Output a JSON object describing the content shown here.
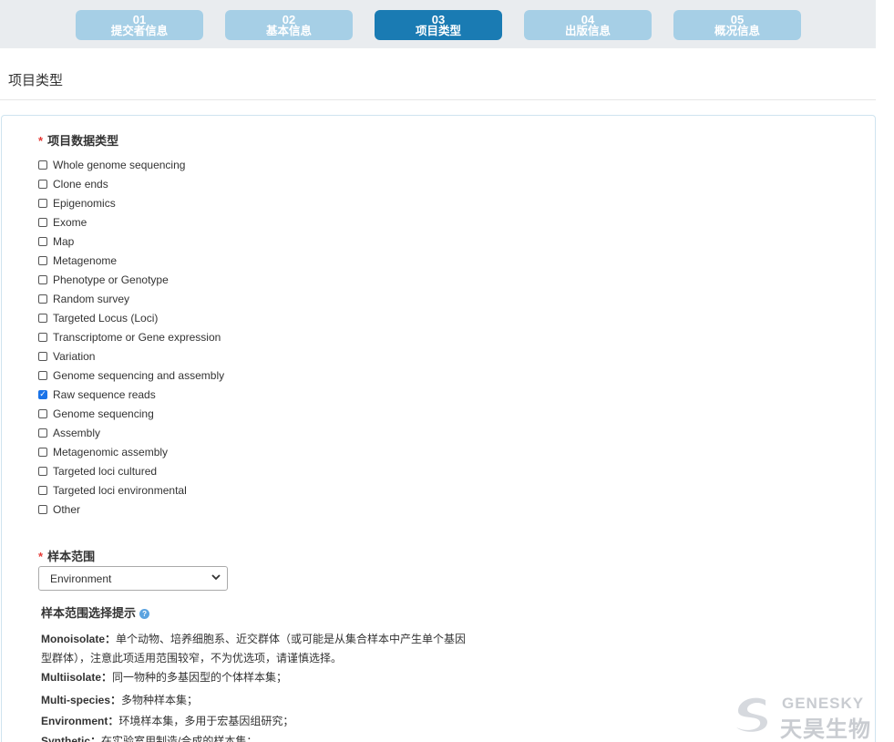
{
  "steps": [
    {
      "num": "01",
      "label": "提交者信息",
      "active": false
    },
    {
      "num": "02",
      "label": "基本信息",
      "active": false
    },
    {
      "num": "03",
      "label": "项目类型",
      "active": true
    },
    {
      "num": "04",
      "label": "出版信息",
      "active": false
    },
    {
      "num": "05",
      "label": "概况信息",
      "active": false
    }
  ],
  "section_title": "项目类型",
  "data_type": {
    "required_mark": "*",
    "label": "项目数据类型",
    "options": [
      {
        "label": "Whole genome sequencing",
        "checked": false
      },
      {
        "label": "Clone ends",
        "checked": false
      },
      {
        "label": "Epigenomics",
        "checked": false
      },
      {
        "label": "Exome",
        "checked": false
      },
      {
        "label": "Map",
        "checked": false
      },
      {
        "label": "Metagenome",
        "checked": false
      },
      {
        "label": "Phenotype or Genotype",
        "checked": false
      },
      {
        "label": "Random survey",
        "checked": false
      },
      {
        "label": "Targeted Locus (Loci)",
        "checked": false
      },
      {
        "label": "Transcriptome or Gene expression",
        "checked": false
      },
      {
        "label": "Variation",
        "checked": false
      },
      {
        "label": "Genome sequencing and assembly",
        "checked": false
      },
      {
        "label": "Raw sequence reads",
        "checked": true
      },
      {
        "label": "Genome sequencing",
        "checked": false
      },
      {
        "label": "Assembly",
        "checked": false
      },
      {
        "label": "Metagenomic assembly",
        "checked": false
      },
      {
        "label": "Targeted loci cultured",
        "checked": false
      },
      {
        "label": "Targeted loci environmental",
        "checked": false
      },
      {
        "label": "Other",
        "checked": false
      }
    ]
  },
  "sample_scope": {
    "required_mark": "*",
    "label": "样本范围",
    "selected": "Environment"
  },
  "hint": {
    "title": "样本范围选择提示",
    "help_icon": "?",
    "items": [
      {
        "term": "Monoisolate：",
        "text": "单个动物、培养细胞系、近交群体（或可能是从集合样本中产生单个基因型群体），注意此项适用范围较窄，不为优选项，请谨慎选择。"
      },
      {
        "term": "Multiisolate：",
        "text": "同一物种的多基因型的个体样本集；"
      },
      {
        "term": "Multi-species：",
        "text": "多物种样本集；"
      },
      {
        "term": "Environment：",
        "text": "环境样本集，多用于宏基因组研究；"
      },
      {
        "term": "Synthetic：",
        "text": "在实验室用制造/合成的样本集；"
      }
    ]
  },
  "watermark": {
    "en": "GENESKY",
    "cn": "天昊生物"
  },
  "colors": {
    "step_active": "#1a7bb3",
    "step_inactive": "#a6cfe6",
    "required": "#e53935",
    "checkbox_checked": "#1a73e8"
  }
}
